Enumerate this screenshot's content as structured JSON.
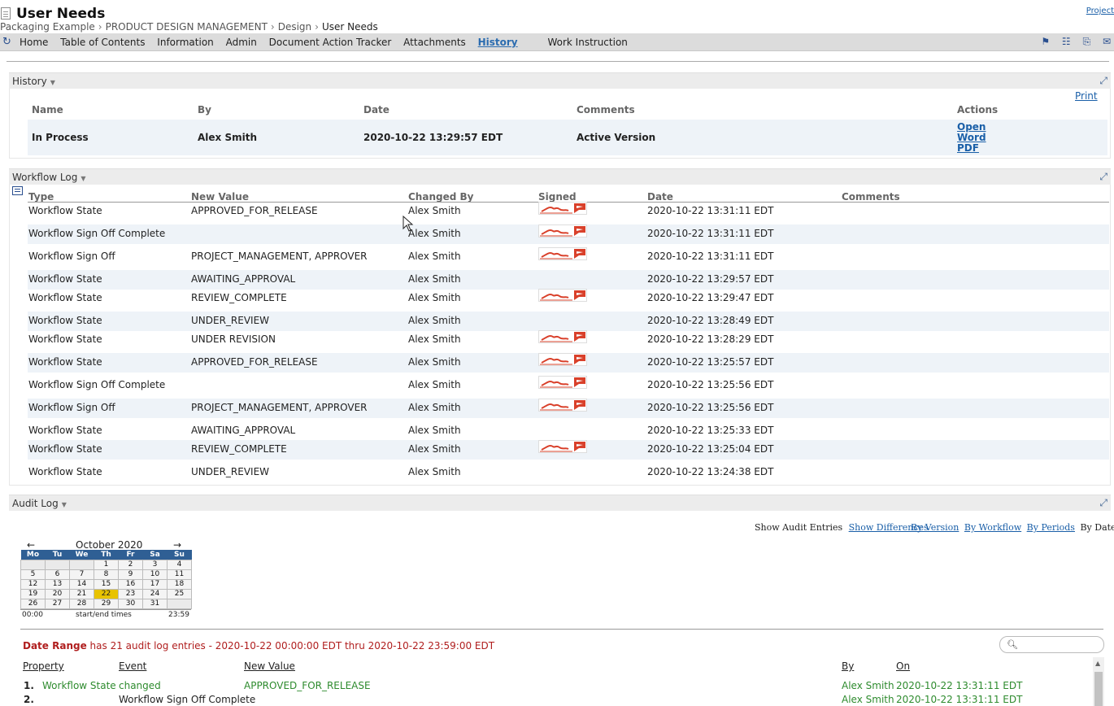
{
  "title_bar": {
    "title": "User Needs",
    "project_link": "Project"
  },
  "breadcrumb": {
    "root": "Packaging Example",
    "sep": "›",
    "section": "PRODUCT DESIGN MANAGEMENT",
    "sub": "Design",
    "current": "User Needs"
  },
  "nav": {
    "items": [
      "Home",
      "Table of Contents",
      "Information",
      "Admin",
      "Document Action Tracker",
      "Attachments",
      "History",
      "Work Instruction"
    ],
    "active": "History"
  },
  "history_panel": {
    "title": "History",
    "print": "Print",
    "headers": {
      "name": "Name",
      "by": "By",
      "date": "Date",
      "comments": "Comments",
      "actions": "Actions"
    },
    "row": {
      "name": "In Process",
      "by": "Alex Smith",
      "date": "2020-10-22 13:29:57 EDT",
      "comments": "Active Version",
      "open": "Open",
      "word": "Word",
      "pdf": "PDF"
    }
  },
  "workflow_panel": {
    "title": "Workflow Log",
    "headers": {
      "type": "Type",
      "new_value": "New Value",
      "changed_by": "Changed By",
      "signed": "Signed",
      "date": "Date",
      "comments": "Comments"
    },
    "rows": [
      {
        "type": "Workflow State",
        "value": "APPROVED_FOR_RELEASE",
        "by": "Alex Smith",
        "signed": true,
        "date": "2020-10-22 13:31:11 EDT"
      },
      {
        "type": "Workflow Sign Off Complete",
        "value": "",
        "by": "Alex Smith",
        "signed": true,
        "date": "2020-10-22 13:31:11 EDT"
      },
      {
        "type": "Workflow Sign Off",
        "value": "PROJECT_MANAGEMENT, APPROVER",
        "by": "Alex Smith",
        "signed": true,
        "date": "2020-10-22 13:31:11 EDT"
      },
      {
        "type": "Workflow State",
        "value": "AWAITING_APPROVAL",
        "by": "Alex Smith",
        "signed": false,
        "date": "2020-10-22 13:29:57 EDT"
      },
      {
        "type": "Workflow State",
        "value": "REVIEW_COMPLETE",
        "by": "Alex Smith",
        "signed": true,
        "date": "2020-10-22 13:29:47 EDT"
      },
      {
        "type": "Workflow State",
        "value": "UNDER_REVIEW",
        "by": "Alex Smith",
        "signed": false,
        "date": "2020-10-22 13:28:49 EDT"
      },
      {
        "type": "Workflow State",
        "value": "UNDER REVISION",
        "by": "Alex Smith",
        "signed": true,
        "date": "2020-10-22 13:28:29 EDT"
      },
      {
        "type": "Workflow State",
        "value": "APPROVED_FOR_RELEASE",
        "by": "Alex Smith",
        "signed": true,
        "date": "2020-10-22 13:25:57 EDT"
      },
      {
        "type": "Workflow Sign Off Complete",
        "value": "",
        "by": "Alex Smith",
        "signed": true,
        "date": "2020-10-22 13:25:56 EDT"
      },
      {
        "type": "Workflow Sign Off",
        "value": "PROJECT_MANAGEMENT, APPROVER",
        "by": "Alex Smith",
        "signed": true,
        "date": "2020-10-22 13:25:56 EDT"
      },
      {
        "type": "Workflow State",
        "value": "AWAITING_APPROVAL",
        "by": "Alex Smith",
        "signed": false,
        "date": "2020-10-22 13:25:33 EDT"
      },
      {
        "type": "Workflow State",
        "value": "REVIEW_COMPLETE",
        "by": "Alex Smith",
        "signed": true,
        "date": "2020-10-22 13:25:04 EDT"
      },
      {
        "type": "Workflow State",
        "value": "UNDER_REVIEW",
        "by": "Alex Smith",
        "signed": false,
        "date": "2020-10-22 13:24:38 EDT"
      }
    ]
  },
  "audit_panel": {
    "title": "Audit Log",
    "show_entries": "Show Audit Entries",
    "show_differences": "Show Differences",
    "by_version": "By Version",
    "by_workflow": "By Workflow",
    "by_periods": "By Periods",
    "by_date_range": "By Date Range",
    "calendar": {
      "prev": "←",
      "next": "→",
      "month": "October 2020",
      "days": [
        "Mo",
        "Tu",
        "We",
        "Th",
        "Fr",
        "Sa",
        "Su"
      ],
      "weeks": [
        [
          "",
          "",
          "",
          "1",
          "2",
          "3",
          "4"
        ],
        [
          "5",
          "6",
          "7",
          "8",
          "9",
          "10",
          "11"
        ],
        [
          "12",
          "13",
          "14",
          "15",
          "16",
          "17",
          "18"
        ],
        [
          "19",
          "20",
          "21",
          "22",
          "23",
          "24",
          "25"
        ],
        [
          "26",
          "27",
          "28",
          "29",
          "30",
          "31",
          ""
        ]
      ],
      "selected": "22",
      "start": "00:00",
      "label": "start/end times",
      "end": "23:59"
    },
    "date_range_label": "Date Range",
    "date_range_text": " has 21 audit log entries - 2020-10-22 00:00:00 EDT thru 2020-10-22 23:59:00 EDT",
    "headers": {
      "property": "Property",
      "event": "Event",
      "new_value": "New Value",
      "by": "By",
      "on": "On"
    },
    "rows": [
      {
        "num": "1.",
        "property": "Workflow State",
        "event": "changed",
        "value": "APPROVED_FOR_RELEASE",
        "by": "Alex Smith",
        "on": "2020-10-22 13:31:11 EDT"
      },
      {
        "num": "2.",
        "property": "",
        "event": "Workflow Sign Off Complete",
        "value": "",
        "by": "Alex Smith",
        "on": "2020-10-22 13:31:11 EDT"
      }
    ]
  },
  "colors": {
    "nav_bg": "#dcdcdc",
    "link": "#1a5fa8",
    "row_alt": "#eef3f8",
    "calendar_header": "#2f5f94",
    "calendar_today": "#e8c300",
    "red": "#b01e1e",
    "green": "#2e8b2e",
    "signature": "#d9402a"
  }
}
